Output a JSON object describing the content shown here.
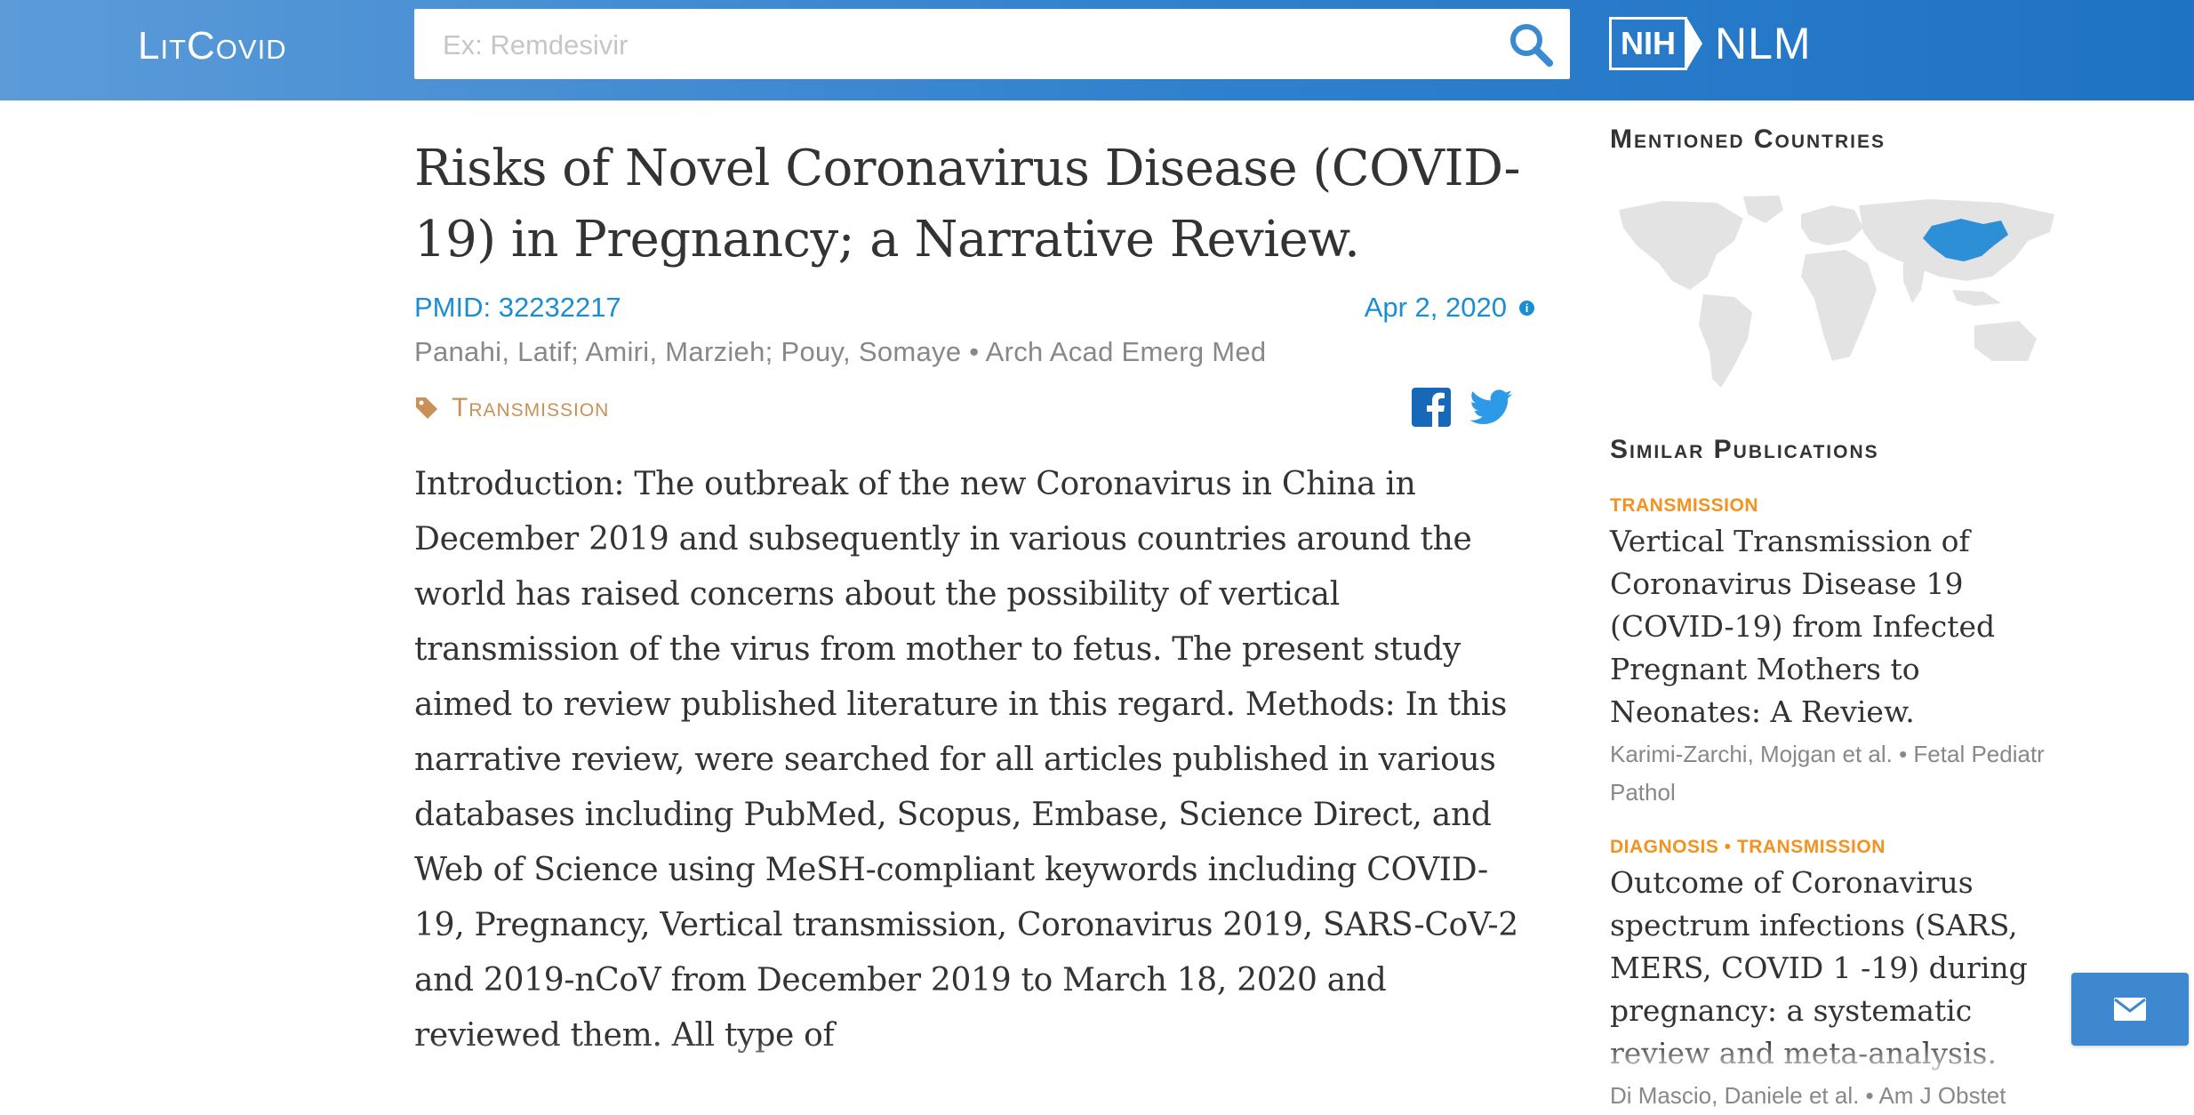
{
  "header": {
    "logo": "LitCovid",
    "search_placeholder": "Ex: Remdesivir",
    "nih_label": "NIH",
    "nlm_label": "NLM"
  },
  "article": {
    "title": "Risks of Novel Coronavirus Disease (COVID-19) in Pregnancy; a Narrative Review.",
    "pmid_label": "PMID:",
    "pmid_value": "32232217",
    "date": "Apr 2, 2020",
    "authors": "Panahi, Latif; Amiri, Marzieh; Pouy, Somaye • Arch Acad Emerg Med",
    "tag": "Transmission",
    "abstract": "Introduction: The outbreak of the new Coronavirus in China in December 2019 and subsequently in various countries around the world has raised concerns about the possibility of vertical transmission of the virus from mother to fetus. The present study aimed to review published literature in this regard. Methods: In this narrative review, were searched for all articles published in various databases including PubMed, Scopus, Embase, Science Direct, and Web of Science using MeSH-compliant keywords including COVID-19, Pregnancy, Vertical transmission, Coronavirus 2019, SARS-CoV-2 and 2019-nCoV from December 2019 to March 18, 2020 and reviewed them. All type of"
  },
  "sidebar": {
    "countries_heading": "Mentioned Countries",
    "similar_heading": "Similar Publications",
    "highlight_color": "#2d8fd5",
    "publications": [
      {
        "tags": "Transmission",
        "title": "Vertical Transmission of Coronavirus Disease 19 (COVID-19) from Infected Pregnant Mothers to Neonates: A Review.",
        "meta": "Karimi-Zarchi, Mojgan et al. • Fetal Pediatr Pathol"
      },
      {
        "tags": "Diagnosis • Transmission",
        "title": "Outcome of Coronavirus spectrum infections (SARS, MERS, COVID 1 -19) during pregnancy: a systematic review and meta-analysis.",
        "meta": "Di Mascio, Daniele et al. • Am J Obstet"
      }
    ]
  },
  "icons": {
    "search": "search-icon",
    "info": "info-icon",
    "tag": "tag-icon",
    "facebook": "facebook-icon",
    "twitter": "twitter-icon",
    "mail": "mail-icon"
  }
}
